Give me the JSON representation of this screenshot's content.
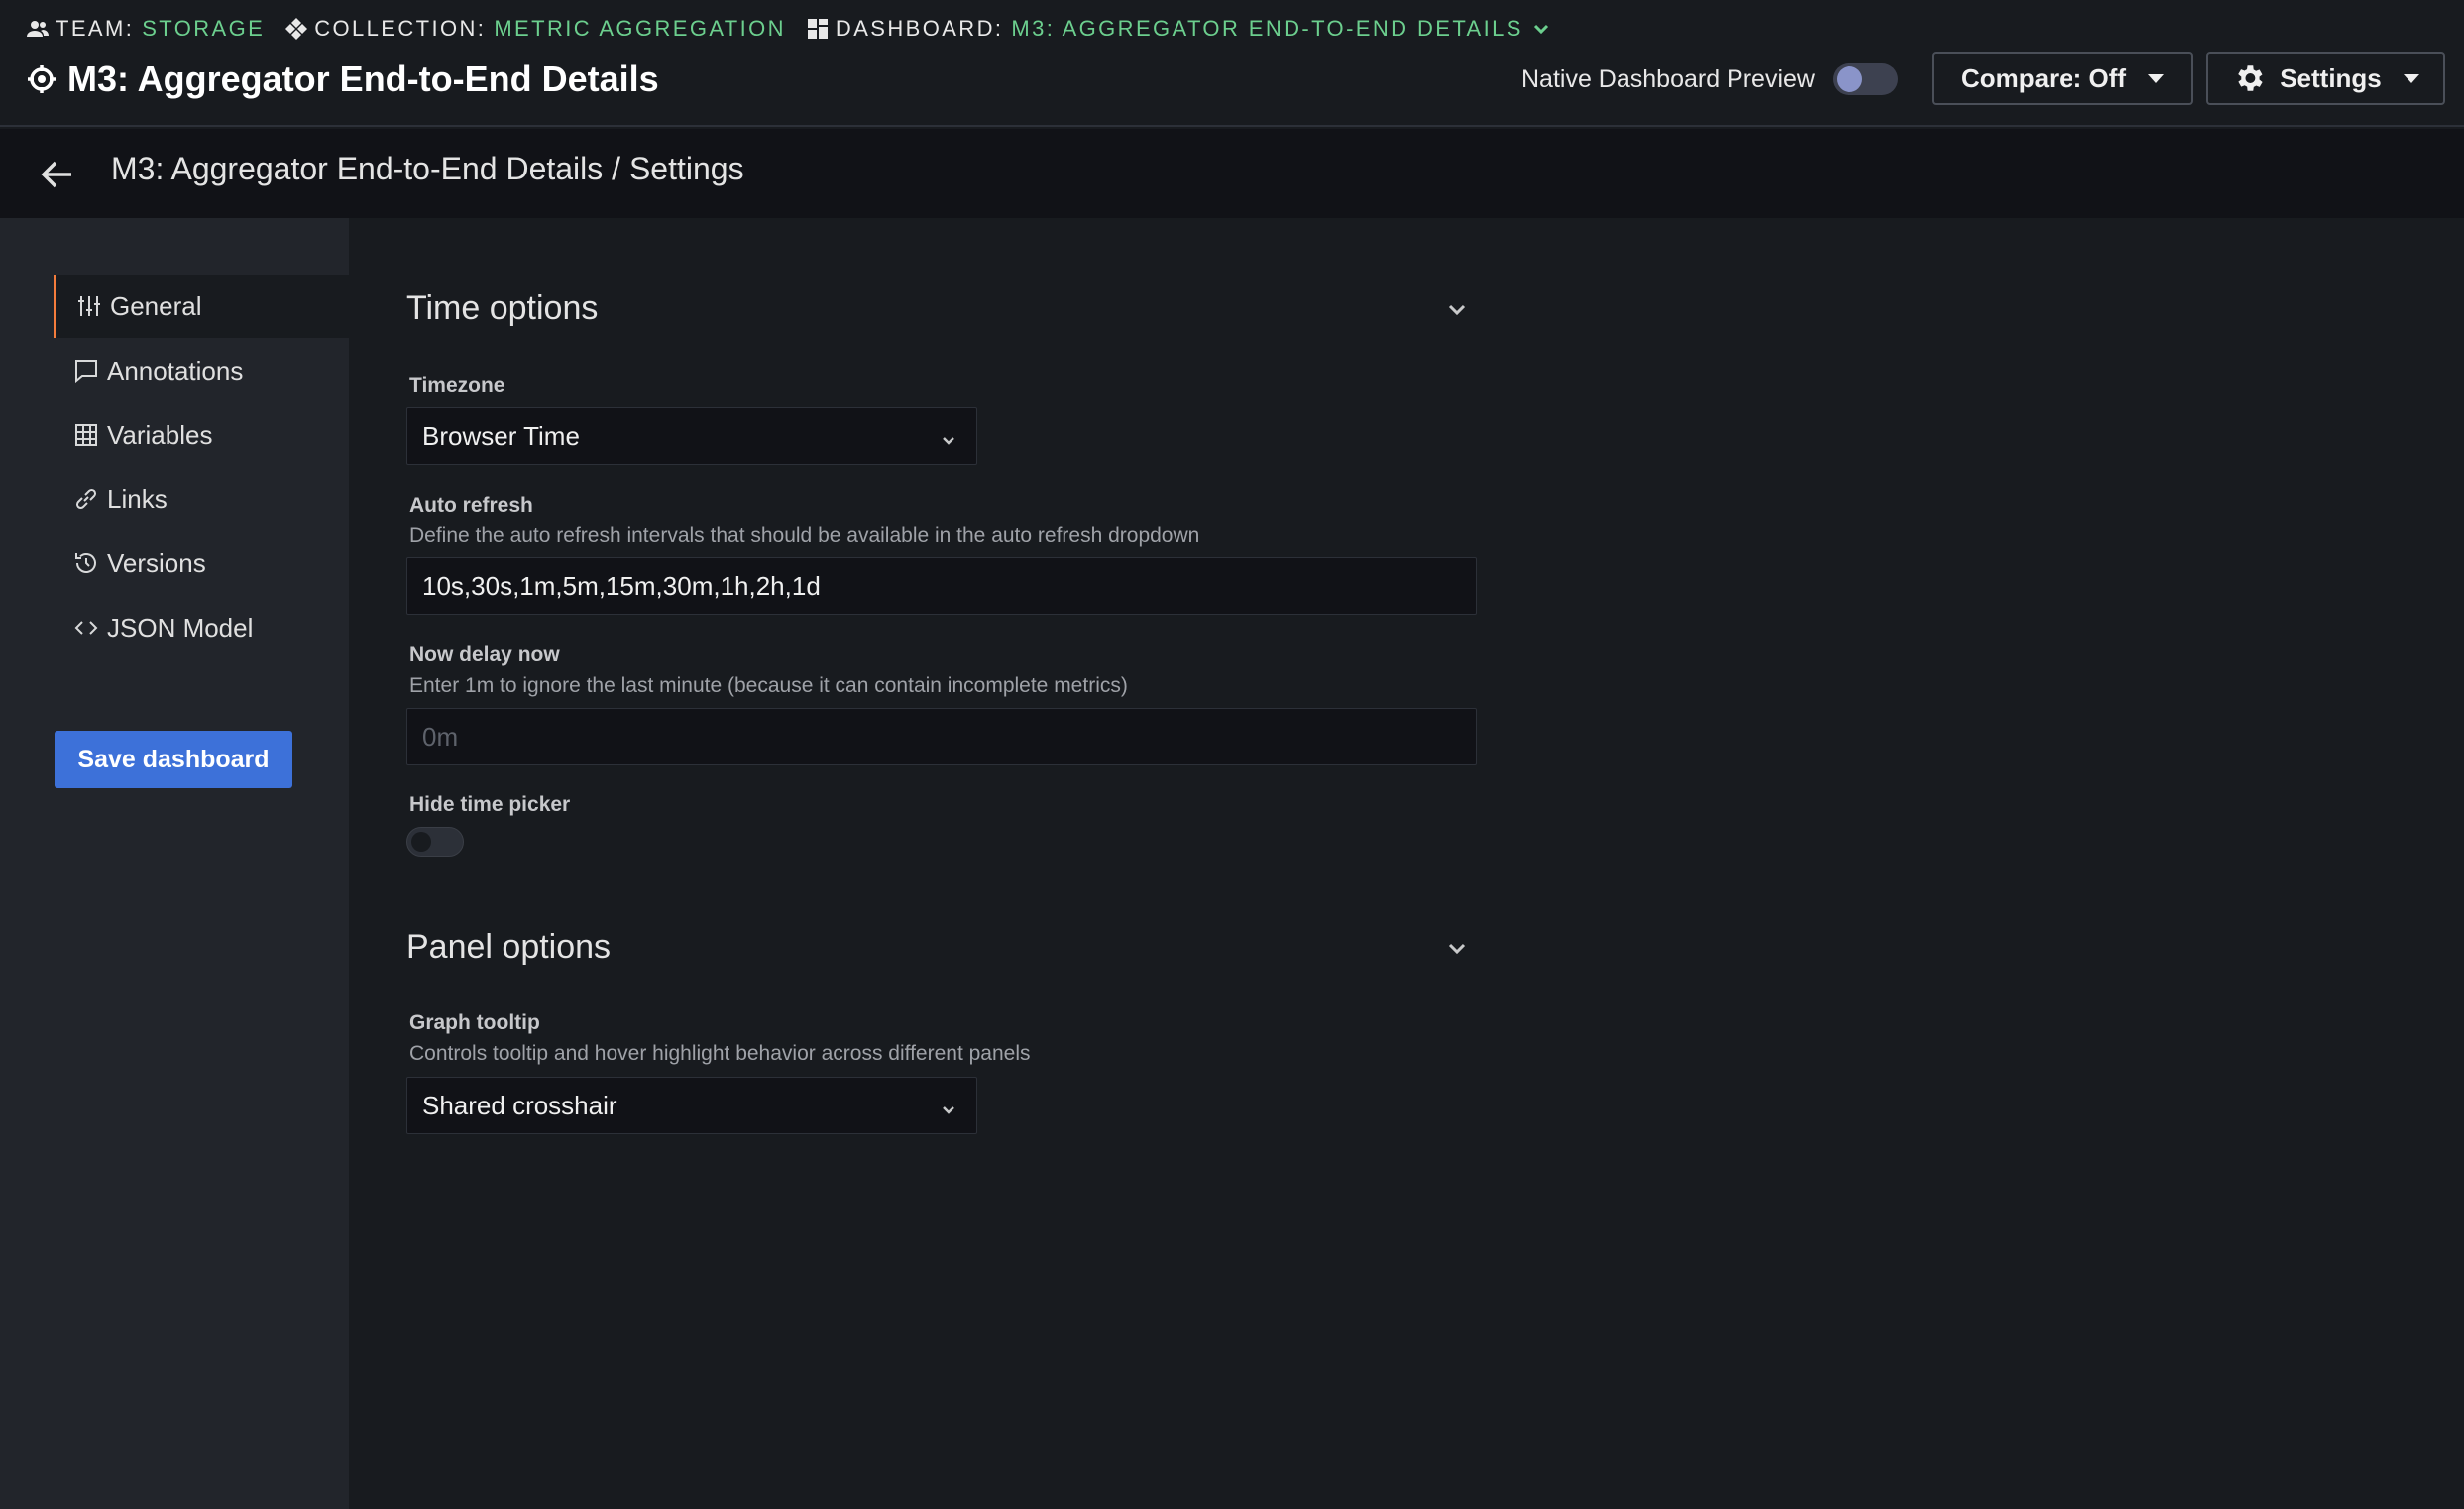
{
  "header": {
    "breadcrumbs": [
      {
        "key": "TEAM:",
        "value": "STORAGE",
        "icon": "users-icon"
      },
      {
        "key": "COLLECTION:",
        "value": "METRIC AGGREGATION",
        "icon": "collection-icon"
      },
      {
        "key": "DASHBOARD:",
        "value": "M3: AGGREGATOR END-TO-END DETAILS",
        "icon": "dashboard-icon"
      }
    ],
    "title": "M3: Aggregator End-to-End Details",
    "preview_label": "Native Dashboard Preview",
    "preview_enabled": false,
    "compare_label": "Compare: Off",
    "settings_label": "Settings"
  },
  "subbar": {
    "title": "M3: Aggregator End-to-End Details / Settings"
  },
  "sidebar": {
    "items": [
      {
        "label": "General",
        "icon": "sliders-icon",
        "active": true
      },
      {
        "label": "Annotations",
        "icon": "comment-icon",
        "active": false
      },
      {
        "label": "Variables",
        "icon": "table-icon",
        "active": false
      },
      {
        "label": "Links",
        "icon": "link-icon",
        "active": false
      },
      {
        "label": "Versions",
        "icon": "history-icon",
        "active": false
      },
      {
        "label": "JSON Model",
        "icon": "code-icon",
        "active": false
      }
    ],
    "save_label": "Save dashboard"
  },
  "time_options": {
    "title": "Time options",
    "timezone_label": "Timezone",
    "timezone_value": "Browser Time",
    "auto_refresh_label": "Auto refresh",
    "auto_refresh_desc": "Define the auto refresh intervals that should be available in the auto refresh dropdown",
    "auto_refresh_value": "10s,30s,1m,5m,15m,30m,1h,2h,1d",
    "now_delay_label": "Now delay now",
    "now_delay_desc": "Enter 1m to ignore the last minute (because it can contain incomplete metrics)",
    "now_delay_placeholder": "0m",
    "hide_picker_label": "Hide time picker",
    "hide_picker_enabled": false
  },
  "panel_options": {
    "title": "Panel options",
    "graph_tooltip_label": "Graph tooltip",
    "graph_tooltip_desc": "Controls tooltip and hover highlight behavior across different panels",
    "graph_tooltip_value": "Shared crosshair"
  },
  "colors": {
    "accent_green": "#6ccf8e",
    "primary_blue": "#3d71d9",
    "active_marker": "#f47c3c"
  }
}
